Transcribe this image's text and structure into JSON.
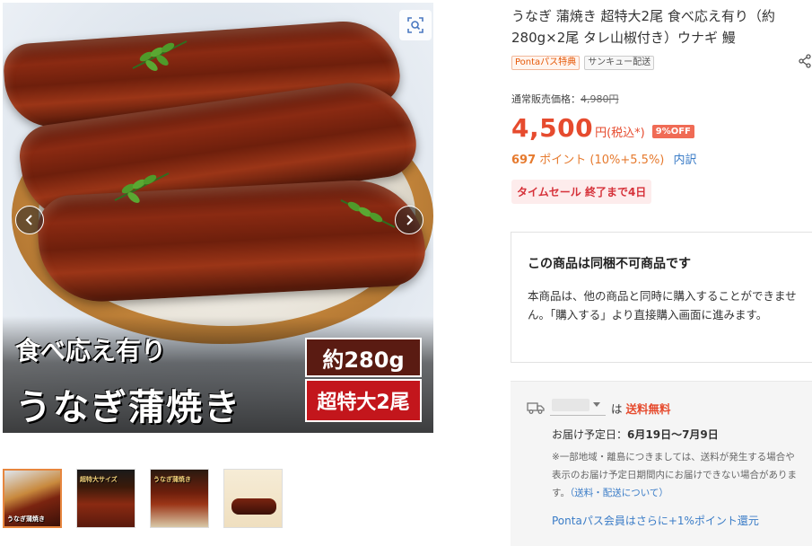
{
  "gallery": {
    "caption_line1": "食べ応え有り",
    "caption_line2": "うなぎ蒲焼き",
    "weight_label": "約280g",
    "size_label": "超特大2尾",
    "thumbnails": [
      {
        "label": "うなぎ蒲焼き",
        "active": true
      },
      {
        "label": "超特大サイズ",
        "active": false
      },
      {
        "label": "うなぎ蒲焼き",
        "active": false
      },
      {
        "label": "",
        "active": false
      }
    ]
  },
  "product": {
    "title": "うなぎ 蒲焼き 超特大2尾 食べ応え有り（約280g×2尾 タレ山椒付き）ウナギ 鰻",
    "badges": [
      "Pontaパス特典",
      "サンキュー配送"
    ],
    "list_price_label": "通常販売価格：",
    "list_price": "4,980円",
    "price": "4,500",
    "price_unit": "円(税込*)",
    "discount": "9%OFF",
    "points_value": "697",
    "points_text": "ポイント (10%+5.5%)",
    "points_detail": "内訳",
    "timesale": "タイムセール 終了まで4日"
  },
  "notice": {
    "title": "この商品は同梱不可商品です",
    "body": "本商品は、他の商品と同時に購入することができません。「購入する」より直接購入画面に進みます。"
  },
  "shipping": {
    "prefix": "は",
    "free_label": "送料無料",
    "eta_label": "お届け予定日：",
    "eta_value": "6月19日〜7月9日",
    "note_text": "※一部地域・離島につきましては、送料が発生する場合や表示のお届け予定日期間内にお届けできない場合があります。",
    "note_link": "（送料・配送について）",
    "ponta_note": "Pontaパス会員はさらに+1%ポイント還元"
  },
  "colors": {
    "price_red": "#e64b2e",
    "points_orange": "#e67a2e",
    "link_blue": "#3a7cc7",
    "timesale_bg": "#fdecec"
  }
}
